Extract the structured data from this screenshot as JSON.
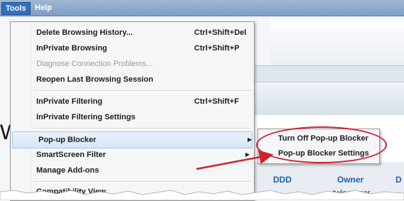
{
  "menubar": {
    "items": [
      {
        "label": "Tools",
        "active": true
      },
      {
        "label": "Help",
        "active": false
      }
    ]
  },
  "tools_menu": {
    "items": [
      {
        "label": "Delete Browsing History...",
        "shortcut": "Ctrl+Shift+Del",
        "disabled": false,
        "submenu": false
      },
      {
        "label": "InPrivate Browsing",
        "shortcut": "Ctrl+Shift+P",
        "disabled": false,
        "submenu": false
      },
      {
        "label": "Diagnose Connection Problems...",
        "shortcut": "",
        "disabled": true,
        "submenu": false
      },
      {
        "label": "Reopen Last Browsing Session",
        "shortcut": "",
        "disabled": false,
        "submenu": false
      },
      {
        "label": "InPrivate Filtering",
        "shortcut": "Ctrl+Shift+F",
        "disabled": false,
        "submenu": false
      },
      {
        "label": "InPrivate Filtering Settings",
        "shortcut": "",
        "disabled": false,
        "submenu": false
      },
      {
        "label": "Pop-up Blocker",
        "shortcut": "",
        "disabled": false,
        "submenu": true,
        "highlighted": true
      },
      {
        "label": "SmartScreen Filter",
        "shortcut": "",
        "disabled": false,
        "submenu": true
      },
      {
        "label": "Manage Add-ons",
        "shortcut": "",
        "disabled": false,
        "submenu": false
      },
      {
        "label": "Compatibility View",
        "shortcut": "",
        "disabled": false,
        "submenu": false
      }
    ]
  },
  "popup_submenu": {
    "items": [
      {
        "label": "Turn Off Pop-up Blocker"
      },
      {
        "label": "Pop-up Blocker Settings"
      }
    ]
  },
  "background": {
    "cut_letter": "W",
    "table_headers": [
      "DDD",
      "Owner",
      "D"
    ],
    "user_cell": "twlec_user"
  },
  "annotation": {
    "color": "#d0222e"
  }
}
